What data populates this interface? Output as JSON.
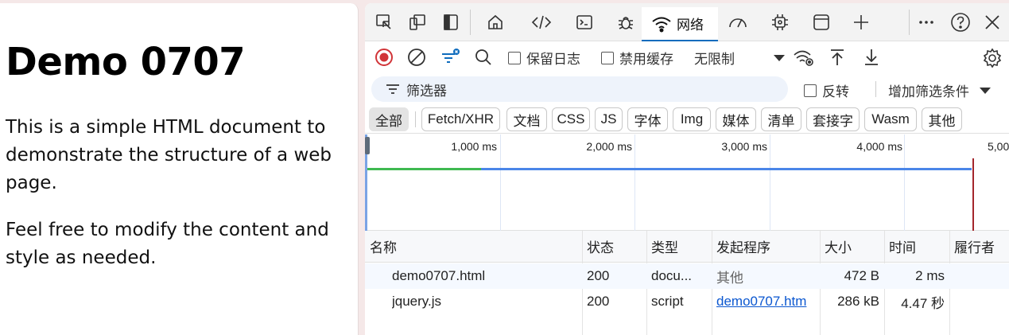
{
  "page": {
    "title": "Demo 0707",
    "paragraphs": [
      "This is a simple HTML document to demonstrate the structure of a web page.",
      "Feel free to modify the content and style as needed."
    ]
  },
  "devtools": {
    "tabs": {
      "network_label": "网络"
    },
    "toolbar": {
      "preserve_log": "保留日志",
      "disable_cache": "禁用缓存",
      "throttling": "无限制"
    },
    "filter": {
      "placeholder": "筛选器",
      "invert": "反转",
      "more_filters": "增加筛选条件"
    },
    "type_filters": [
      "全部",
      "Fetch/XHR",
      "文档",
      "CSS",
      "JS",
      "字体",
      "Img",
      "媒体",
      "清单",
      "套接字",
      "Wasm",
      "其他"
    ],
    "overview": {
      "ticks": [
        "1,000 ms",
        "2,000 ms",
        "3,000 ms",
        "4,000 ms",
        "5,00"
      ]
    },
    "table": {
      "headers": [
        "名称",
        "状态",
        "类型",
        "发起程序",
        "大小",
        "时间",
        "履行者"
      ],
      "rows": [
        {
          "name": "demo0707.html",
          "status": "200",
          "type": "docu...",
          "initiator": "其他",
          "size": "472 B",
          "time": "2 ms"
        },
        {
          "name": "jquery.js",
          "status": "200",
          "type": "script",
          "initiator": "demo0707.htm",
          "size": "286 kB",
          "time": "4.47 秒"
        }
      ]
    }
  },
  "colors": {
    "accent": "#0f6cbd",
    "record_red": "#d13438",
    "waterfall_green": "#3fb950",
    "waterfall_blue": "#4a86e8",
    "load_line": "#a4262c"
  }
}
